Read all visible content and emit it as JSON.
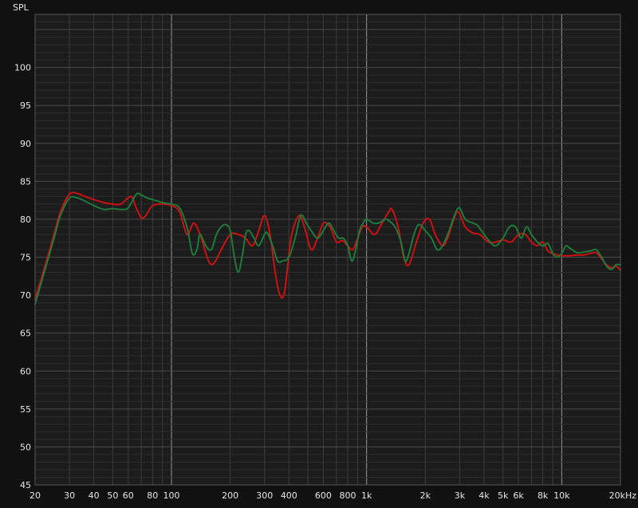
{
  "chart_data": {
    "type": "line",
    "title": "",
    "ylabel": "SPL",
    "xlabel": "",
    "x_scale": "log",
    "xlim": [
      20,
      20000
    ],
    "ylim": [
      45,
      107
    ],
    "grid": true,
    "x_ticks": [
      {
        "value": 20,
        "label": "20"
      },
      {
        "value": 30,
        "label": "30"
      },
      {
        "value": 40,
        "label": "40"
      },
      {
        "value": 50,
        "label": "50"
      },
      {
        "value": 60,
        "label": "60"
      },
      {
        "value": 80,
        "label": "80"
      },
      {
        "value": 100,
        "label": "100"
      },
      {
        "value": 200,
        "label": "200"
      },
      {
        "value": 300,
        "label": "300"
      },
      {
        "value": 400,
        "label": "400"
      },
      {
        "value": 600,
        "label": "600"
      },
      {
        "value": 800,
        "label": "800"
      },
      {
        "value": 1000,
        "label": "1k"
      },
      {
        "value": 2000,
        "label": "2k"
      },
      {
        "value": 3000,
        "label": "3k"
      },
      {
        "value": 4000,
        "label": "4k"
      },
      {
        "value": 5000,
        "label": "5k"
      },
      {
        "value": 6000,
        "label": "6k"
      },
      {
        "value": 8000,
        "label": "8k"
      },
      {
        "value": 10000,
        "label": "10k"
      },
      {
        "value": 20000,
        "label": "20kHz"
      }
    ],
    "y_ticks": [
      45,
      50,
      55,
      60,
      65,
      70,
      75,
      80,
      85,
      90,
      95,
      100
    ],
    "series": [
      {
        "color": "#cc1111",
        "points": [
          [
            20,
            69.5
          ],
          [
            22,
            73
          ],
          [
            25,
            78
          ],
          [
            27,
            81
          ],
          [
            30,
            83.3
          ],
          [
            33,
            83.4
          ],
          [
            36,
            83
          ],
          [
            40,
            82.6
          ],
          [
            45,
            82.2
          ],
          [
            50,
            82
          ],
          [
            55,
            82
          ],
          [
            62,
            83
          ],
          [
            66,
            81.5
          ],
          [
            70,
            80.2
          ],
          [
            74,
            80.5
          ],
          [
            80,
            81.8
          ],
          [
            90,
            82
          ],
          [
            100,
            81.8
          ],
          [
            110,
            81
          ],
          [
            120,
            78
          ],
          [
            130,
            79.5
          ],
          [
            140,
            78
          ],
          [
            155,
            74.5
          ],
          [
            165,
            74.2
          ],
          [
            180,
            76
          ],
          [
            200,
            78
          ],
          [
            220,
            78
          ],
          [
            240,
            77.5
          ],
          [
            260,
            76.5
          ],
          [
            280,
            78.5
          ],
          [
            300,
            80.5
          ],
          [
            320,
            78
          ],
          [
            340,
            73
          ],
          [
            360,
            70
          ],
          [
            380,
            70.5
          ],
          [
            410,
            77.5
          ],
          [
            450,
            80.5
          ],
          [
            480,
            79
          ],
          [
            520,
            76
          ],
          [
            560,
            77.5
          ],
          [
            600,
            79.5
          ],
          [
            650,
            79
          ],
          [
            700,
            77
          ],
          [
            750,
            77.2
          ],
          [
            800,
            76.5
          ],
          [
            850,
            76
          ],
          [
            900,
            77.5
          ],
          [
            950,
            79
          ],
          [
            1000,
            79
          ],
          [
            1100,
            78
          ],
          [
            1200,
            79.5
          ],
          [
            1300,
            81
          ],
          [
            1350,
            81.3
          ],
          [
            1450,
            79
          ],
          [
            1550,
            75
          ],
          [
            1650,
            74
          ],
          [
            1800,
            77
          ],
          [
            1950,
            79.5
          ],
          [
            2100,
            80
          ],
          [
            2250,
            78
          ],
          [
            2450,
            76.5
          ],
          [
            2600,
            77.5
          ],
          [
            2800,
            80
          ],
          [
            2950,
            81
          ],
          [
            3200,
            79
          ],
          [
            3500,
            78.2
          ],
          [
            3800,
            78
          ],
          [
            4200,
            77
          ],
          [
            4600,
            77
          ],
          [
            5000,
            77.3
          ],
          [
            5500,
            77
          ],
          [
            6000,
            78
          ],
          [
            6500,
            78
          ],
          [
            7000,
            77
          ],
          [
            7500,
            76.5
          ],
          [
            8000,
            77
          ],
          [
            8500,
            75.8
          ],
          [
            9000,
            75.5
          ],
          [
            9500,
            75.3
          ],
          [
            10000,
            75.2
          ],
          [
            11000,
            75.2
          ],
          [
            12000,
            75.3
          ],
          [
            13000,
            75.3
          ],
          [
            14000,
            75.5
          ],
          [
            15000,
            75.6
          ],
          [
            16000,
            74.8
          ],
          [
            17000,
            74
          ],
          [
            18000,
            73.6
          ],
          [
            19000,
            73.8
          ],
          [
            20000,
            73.3
          ]
        ]
      },
      {
        "color": "#1e7a3a",
        "points": [
          [
            20,
            68.8
          ],
          [
            22,
            72.5
          ],
          [
            25,
            77.5
          ],
          [
            27,
            80.5
          ],
          [
            30,
            82.8
          ],
          [
            33,
            82.8
          ],
          [
            36,
            82.4
          ],
          [
            40,
            81.8
          ],
          [
            45,
            81.3
          ],
          [
            50,
            81.4
          ],
          [
            55,
            81.3
          ],
          [
            60,
            81.5
          ],
          [
            66,
            83.3
          ],
          [
            70,
            83.2
          ],
          [
            75,
            82.8
          ],
          [
            80,
            82.6
          ],
          [
            90,
            82.2
          ],
          [
            100,
            82
          ],
          [
            110,
            81.5
          ],
          [
            120,
            79
          ],
          [
            128,
            75.5
          ],
          [
            135,
            76
          ],
          [
            140,
            78
          ],
          [
            150,
            76.5
          ],
          [
            160,
            76
          ],
          [
            170,
            78
          ],
          [
            180,
            79
          ],
          [
            190,
            79.3
          ],
          [
            200,
            78.5
          ],
          [
            210,
            75
          ],
          [
            220,
            73
          ],
          [
            230,
            75
          ],
          [
            240,
            78
          ],
          [
            250,
            78.5
          ],
          [
            265,
            77.5
          ],
          [
            280,
            76.5
          ],
          [
            300,
            78
          ],
          [
            310,
            78.2
          ],
          [
            330,
            76.5
          ],
          [
            350,
            74.5
          ],
          [
            370,
            74.5
          ],
          [
            400,
            75
          ],
          [
            430,
            77.5
          ],
          [
            460,
            80.5
          ],
          [
            490,
            79.5
          ],
          [
            520,
            78.5
          ],
          [
            560,
            77.5
          ],
          [
            600,
            78.5
          ],
          [
            640,
            79.5
          ],
          [
            680,
            78.5
          ],
          [
            720,
            77.5
          ],
          [
            760,
            77.5
          ],
          [
            800,
            76.5
          ],
          [
            840,
            74.5
          ],
          [
            880,
            76
          ],
          [
            920,
            78.5
          ],
          [
            960,
            79.5
          ],
          [
            1000,
            80
          ],
          [
            1080,
            79.5
          ],
          [
            1150,
            79.5
          ],
          [
            1250,
            80
          ],
          [
            1300,
            79.8
          ],
          [
            1400,
            79
          ],
          [
            1500,
            77
          ],
          [
            1580,
            74.5
          ],
          [
            1650,
            75.5
          ],
          [
            1750,
            78
          ],
          [
            1850,
            79.3
          ],
          [
            2000,
            78.5
          ],
          [
            2150,
            77.5
          ],
          [
            2300,
            76
          ],
          [
            2450,
            76.5
          ],
          [
            2650,
            78.5
          ],
          [
            2850,
            80.8
          ],
          [
            3000,
            81.5
          ],
          [
            3200,
            80
          ],
          [
            3500,
            79.5
          ],
          [
            3700,
            79.2
          ],
          [
            4000,
            78
          ],
          [
            4300,
            77
          ],
          [
            4600,
            76.5
          ],
          [
            5000,
            77.5
          ],
          [
            5400,
            79
          ],
          [
            5800,
            79
          ],
          [
            6200,
            77.5
          ],
          [
            6600,
            79
          ],
          [
            7000,
            78
          ],
          [
            7500,
            77
          ],
          [
            8000,
            76.5
          ],
          [
            8500,
            76.8
          ],
          [
            9000,
            75.5
          ],
          [
            9500,
            75
          ],
          [
            10000,
            75.5
          ],
          [
            10500,
            76.5
          ],
          [
            11000,
            76.2
          ],
          [
            12000,
            75.6
          ],
          [
            13000,
            75.7
          ],
          [
            14000,
            75.8
          ],
          [
            15000,
            76
          ],
          [
            16000,
            75
          ],
          [
            17000,
            73.8
          ],
          [
            18000,
            73.4
          ],
          [
            19000,
            74
          ],
          [
            20000,
            74
          ]
        ]
      }
    ]
  }
}
